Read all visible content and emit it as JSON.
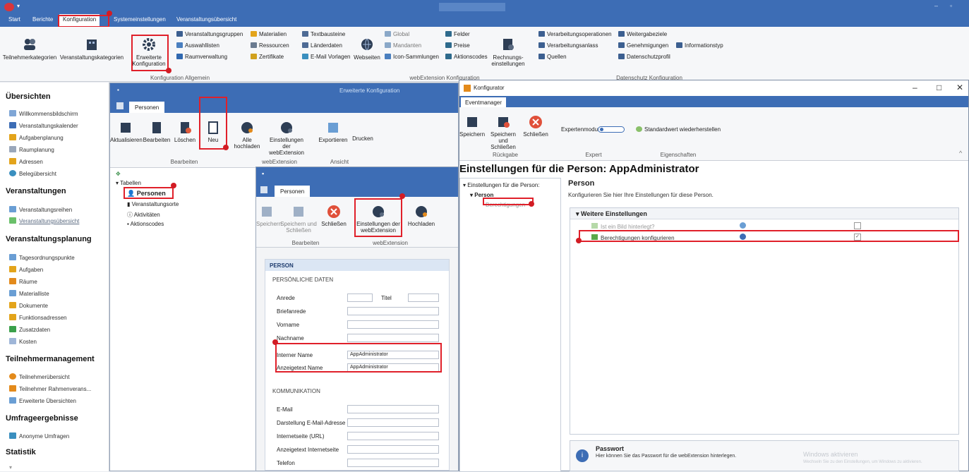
{
  "main_tabs": [
    "Start",
    "Berichte",
    "Konfiguration",
    "Systemeinstellungen",
    "Veranstaltungsübersicht"
  ],
  "ribbon": {
    "big_buttons": [
      "Teilnehmerkategorien",
      "Veranstaltungskategorien",
      "Erweiterte Konfiguration",
      "Webseiten",
      "Rechnungs-einstellungen"
    ],
    "col1": [
      "Veranstaltungsgruppen",
      "Auswahllisten",
      "Raumverwaltung"
    ],
    "col2": [
      "Materialien",
      "Ressourcen",
      "Zertifikate"
    ],
    "col3": [
      "Textbausteine",
      "Länderdaten",
      "E-Mail Vorlagen"
    ],
    "col4": [
      "Global",
      "Mandanten",
      "Icon-Sammlungen"
    ],
    "col5": [
      "Felder",
      "Preise",
      "Aktionscodes"
    ],
    "col6": [
      "Verarbeitungsoperationen",
      "Verarbeitungsanlass",
      "Quellen"
    ],
    "col7": [
      "Weitergabeziele",
      "Genehmigungen",
      "Datenschutzprofil"
    ],
    "col8": [
      "Informationstyp"
    ],
    "groups": [
      "Konfiguration Allgemein",
      "webExtension Konfiguration",
      "Datenschutz Konfiguration"
    ]
  },
  "sidebar": {
    "s1": "Übersichten",
    "s1_items": [
      "Willkommensbildschirm",
      "Veranstaltungskalender",
      "Aufgabenplanung",
      "Raumplanung",
      "Adressen",
      "Belegübersicht"
    ],
    "s2": "Veranstaltungen",
    "s2_items": [
      "Veranstaltungsreihen",
      "Veranstaltungsübersicht"
    ],
    "s3": "Veranstaltungsplanung",
    "s3_items": [
      "Tagesordnungspunkte",
      "Aufgaben",
      "Räume",
      "Materialliste",
      "Dokumente",
      "Funktionsadressen",
      "Zusatzdaten",
      "Kosten"
    ],
    "s4": "Teilnehmermanagement",
    "s4_items": [
      "Teilnehmerübersicht",
      "Teilnehmer Rahmenverans...",
      "Erweiterte Übersichten"
    ],
    "s5": "Umfrageergebnisse",
    "s5_items": [
      "Anonyme Umfragen"
    ],
    "s6": "Statistik"
  },
  "win1": {
    "title": "Erweiterte Konfiguration",
    "tab": "Personen",
    "buttons": [
      "Aktualisieren",
      "Bearbeiten",
      "Löschen",
      "Neu",
      "Alle hochladen",
      "Einstellungen der webExtension",
      "Exportieren",
      "Drucken"
    ],
    "groups": [
      "Bearbeiten",
      "webExtension",
      "Ansicht"
    ],
    "tree_root": "Tabellen",
    "tree": [
      "Personen",
      "Veranstaltungsorte",
      "Aktivitäten",
      "Aktionscodes"
    ]
  },
  "win2": {
    "tab": "Personen",
    "buttons": [
      "Speichern",
      "Speichern und Schließen",
      "Schließen",
      "Einstellungen der webExtension",
      "Hochladen"
    ],
    "groups": [
      "Bearbeiten",
      "webExtension"
    ],
    "form_title": "PERSON",
    "sec1": "PERSÖNLICHE DATEN",
    "labels1": [
      "Anrede",
      "Titel",
      "Briefanrede",
      "Vorname",
      "Nachname",
      "Interner Name",
      "Anzeigetext Name"
    ],
    "internal_name": "AppAdministrator",
    "display_name": "AppAdministrator",
    "sec2": "KOMMUNIKATION",
    "labels2": [
      "E-Mail",
      "Darstellung E-Mail-Adresse",
      "Internetseite (URL)",
      "Anzeigetext Internetseite",
      "Telefon"
    ]
  },
  "win3": {
    "title": "Konfigurator",
    "tab": "Eventmanager",
    "buttons": [
      "Speichern",
      "Speichern und Schließen",
      "Schließen"
    ],
    "expert_label": "Expertenmodus",
    "restore_label": "Standardwert wiederherstellen",
    "groups": [
      "Rückgabe",
      "Expert",
      "Eigenschaften"
    ],
    "heading": "Einstellungen für die Person: AppAdministrator",
    "tree_root": "Einstellungen für die Person:",
    "tree_person": "Person",
    "tree_perm": "Berechtigungen",
    "panel_title": "Person",
    "panel_sub": "Konfigurieren Sie hier Ihre Einstellungen für diese Person.",
    "section": "Weitere Einstellungen",
    "rows": [
      "Ist ein Bild hinterlegt?",
      "Berechtigungen konfigurieren"
    ],
    "info_title": "Passwort",
    "info_text": "Hier können Sie das Passwort für die webExtension hinterlegen.",
    "wm1": "Windows aktivieren",
    "wm2": "Wechseln Sie zu den Einstellungen, um Windows zu aktivieren."
  },
  "colors": {
    "accent": "#3d6db5",
    "highlight": "#e0202a",
    "marker": "#d21c24"
  }
}
